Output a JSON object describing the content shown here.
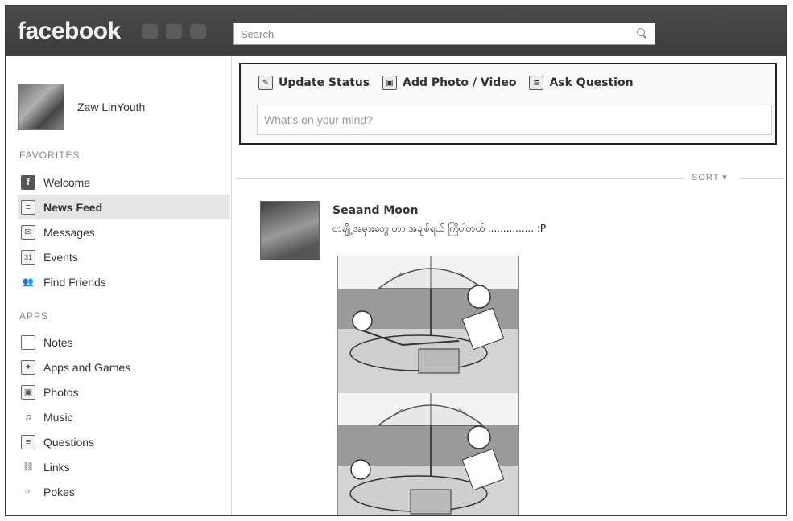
{
  "app": {
    "logo": "facebook"
  },
  "search": {
    "placeholder": "Search"
  },
  "profile": {
    "name": "Zaw LinYouth"
  },
  "favorites": {
    "title": "FAVORITES",
    "items": [
      {
        "label": "Welcome",
        "icon": "facebook-f-icon",
        "glyph": "f",
        "active": false
      },
      {
        "label": "News Feed",
        "icon": "news-feed-icon",
        "glyph": "≡",
        "active": true
      },
      {
        "label": "Messages",
        "icon": "messages-icon",
        "glyph": "✉",
        "active": false
      },
      {
        "label": "Events",
        "icon": "calendar-icon",
        "glyph": "31",
        "active": false
      },
      {
        "label": "Find Friends",
        "icon": "friends-icon",
        "glyph": "👥",
        "active": false
      }
    ]
  },
  "apps": {
    "title": "APPS",
    "items": [
      {
        "label": "Notes",
        "icon": "notes-icon",
        "glyph": ""
      },
      {
        "label": "Apps and Games",
        "icon": "apps-games-icon",
        "glyph": "✦"
      },
      {
        "label": "Photos",
        "icon": "photos-icon",
        "glyph": "▣"
      },
      {
        "label": "Music",
        "icon": "music-icon",
        "glyph": "♫"
      },
      {
        "label": "Questions",
        "icon": "questions-icon",
        "glyph": "≡"
      },
      {
        "label": "Links",
        "icon": "links-icon",
        "glyph": "⛓"
      },
      {
        "label": "Pokes",
        "icon": "pokes-icon",
        "glyph": "☞"
      }
    ]
  },
  "composer": {
    "tabs": [
      {
        "label": "Update Status",
        "icon": "status-icon",
        "glyph": "✎"
      },
      {
        "label": "Add Photo / Video",
        "icon": "photo-icon",
        "glyph": "▣"
      },
      {
        "label": "Ask Question",
        "icon": "question-icon",
        "glyph": "≡"
      }
    ],
    "placeholder": "What's on your mind?"
  },
  "feed": {
    "sort_label": "SORT ▾"
  },
  "post": {
    "author": "Seaand Moon",
    "text": "တချို့ အမှားတွေ ဟာ အချစ်ရယ် ကြိုပါတယ် ............... :P"
  },
  "colors": {
    "topbar": "#3c3c3c",
    "active_item": "#e6e6e6"
  }
}
